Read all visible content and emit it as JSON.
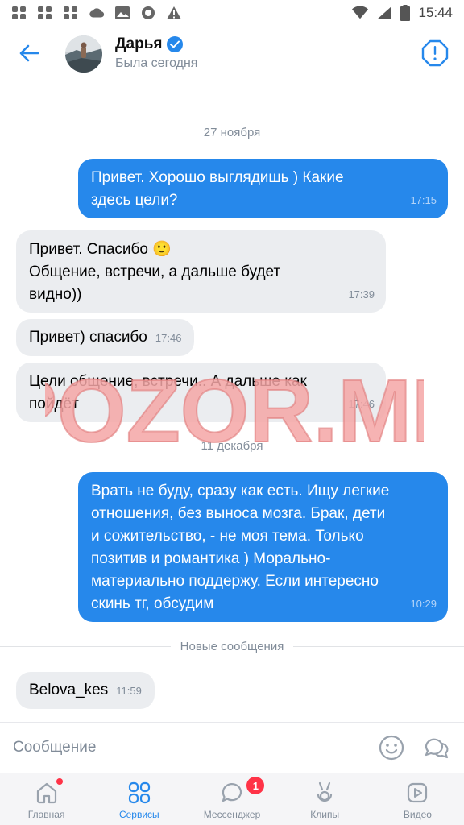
{
  "status_bar": {
    "time": "15:44"
  },
  "header": {
    "name": "Дарья",
    "status": "Была сегодня"
  },
  "messages": {
    "date1": "27 ноября",
    "m1": {
      "text": "Привет. Хорошо выглядишь ) Какие\nздесь цели?",
      "time": "17:15"
    },
    "m2": {
      "text": "Привет. Спасибо 🙂\nОбщение, встречи, а дальше будет\nвидно))",
      "time": "17:39"
    },
    "m3": {
      "text": "Привет) спасибо",
      "time": "17:46"
    },
    "m4": {
      "text": "Цели общение, встречи.. А дальше как\nпойдёт",
      "time": "17:46"
    },
    "date2": "11 декабря",
    "m5": {
      "text": "Врать не буду, сразу как есть. Ищу легкие\nотношения, без выноса мозга. Брак, дети\nи сожительство, - не моя тема. Только\nпозитив и романтика ) Морально-\nматериально поддержу. Если интересно\nскинь тг, обсудим",
      "time": "10:29"
    },
    "new_messages": "Новые сообщения",
    "m6": {
      "text": "Belova_kes",
      "time": "11:59"
    }
  },
  "watermark": "POZOR.ME",
  "composer": {
    "placeholder": "Сообщение"
  },
  "tabs": {
    "home": "Главная",
    "services": "Сервисы",
    "messenger": "Мессенджер",
    "messenger_badge": "1",
    "clips": "Клипы",
    "video": "Видео"
  },
  "colors": {
    "accent": "#2688eb",
    "incoming_bubble": "#ebedf0",
    "badge": "#ff3347",
    "watermark": "#f4a6a6"
  }
}
